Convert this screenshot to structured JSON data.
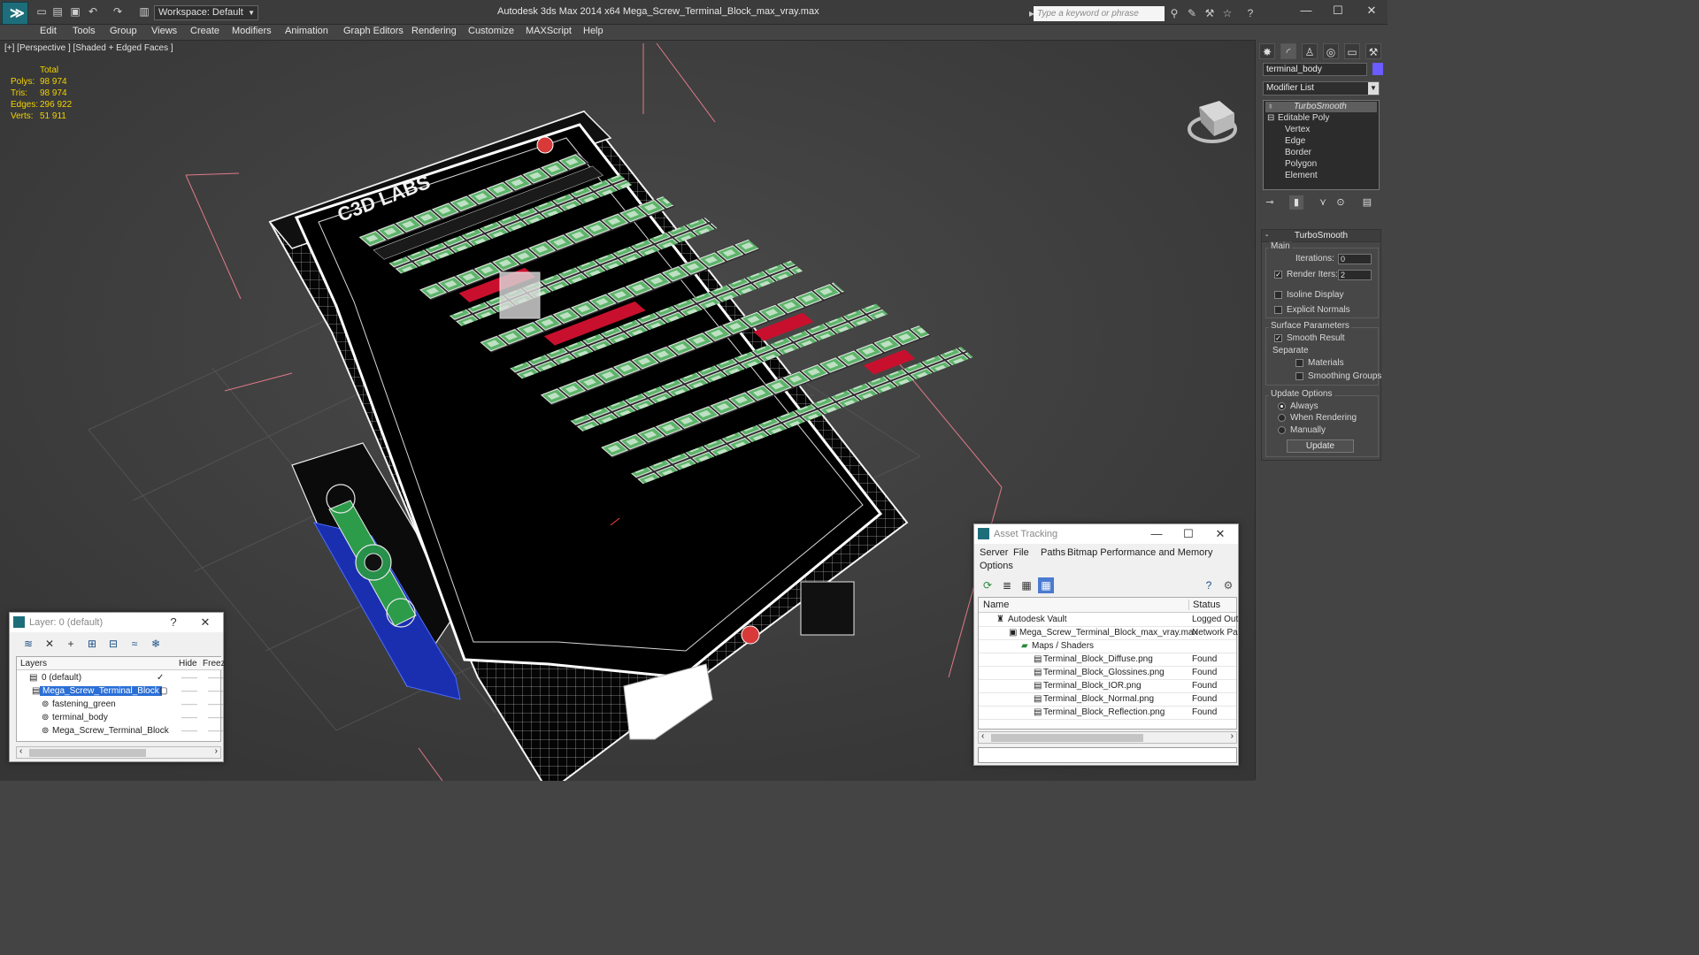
{
  "titlebar": {
    "workspace": "Workspace: Default",
    "title": "Autodesk 3ds Max  2014 x64      Mega_Screw_Terminal_Block_max_vray.max",
    "search_placeholder": "Type a keyword or phrase"
  },
  "menu": [
    "Edit",
    "Tools",
    "Group",
    "Views",
    "Create",
    "Modifiers",
    "Animation",
    "Graph Editors",
    "Rendering",
    "Customize",
    "MAXScript",
    "Help"
  ],
  "viewport": {
    "label": "[+] [Perspective ] [Shaded + Edged Faces ]",
    "stats": {
      "header": "Total",
      "rows": [
        {
          "k": "Polys:",
          "v": "98 974"
        },
        {
          "k": "Tris:",
          "v": "98 974"
        },
        {
          "k": "Edges:",
          "v": "296 922"
        },
        {
          "k": "Verts:",
          "v": "51 911"
        }
      ]
    },
    "model_text": [
      "C3D LABS"
    ]
  },
  "command_panel": {
    "object_name": "terminal_body",
    "object_color": "#6b5cff",
    "modifier_list": "Modifier List",
    "stack": [
      "TurboSmooth",
      "Editable Poly",
      "Vertex",
      "Edge",
      "Border",
      "Polygon",
      "Element"
    ],
    "rollout": {
      "title": "TurboSmooth",
      "main_label": "Main",
      "iterations_label": "Iterations:",
      "iterations_value": "0",
      "render_iters_label": "Render Iters:",
      "render_iters_value": "2",
      "isoline": "Isoline Display",
      "explicit": "Explicit Normals",
      "surface_label": "Surface Parameters",
      "smooth_result": "Smooth Result",
      "separate_label": "Separate",
      "materials": "Materials",
      "smoothing_groups": "Smoothing Groups",
      "update_options_label": "Update Options",
      "always": "Always",
      "when_rendering": "When Rendering",
      "manually": "Manually",
      "update_btn": "Update"
    }
  },
  "layers_window": {
    "title": "Layer: 0 (default)",
    "help": "?",
    "col_layers": "Layers",
    "col_hide": "Hide",
    "col_freeze": "Freez",
    "rows": [
      {
        "name": "0 (default)",
        "indent": 0
      },
      {
        "name": "Mega_Screw_Terminal_Block",
        "indent": 0
      },
      {
        "name": "fastening_green",
        "indent": 1
      },
      {
        "name": "terminal_body",
        "indent": 1
      },
      {
        "name": "Mega_Screw_Terminal_Block",
        "indent": 1
      }
    ]
  },
  "asset_window": {
    "title": "Asset Tracking",
    "menu": [
      "Server",
      "File",
      "Paths",
      "Bitmap Performance and Memory",
      "Options"
    ],
    "col_name": "Name",
    "col_status": "Status",
    "rows": [
      {
        "name": "Autodesk Vault",
        "status": "Logged Out"
      },
      {
        "name": "Mega_Screw_Terminal_Block_max_vray.max",
        "status": "Network Pa"
      },
      {
        "name": "Maps / Shaders",
        "status": ""
      },
      {
        "name": "Terminal_Block_Diffuse.png",
        "status": "Found"
      },
      {
        "name": "Terminal_Block_Glossines.png",
        "status": "Found"
      },
      {
        "name": "Terminal_Block_IOR.png",
        "status": "Found"
      },
      {
        "name": "Terminal_Block_Normal.png",
        "status": "Found"
      },
      {
        "name": "Terminal_Block_Reflection.png",
        "status": "Found"
      }
    ]
  }
}
